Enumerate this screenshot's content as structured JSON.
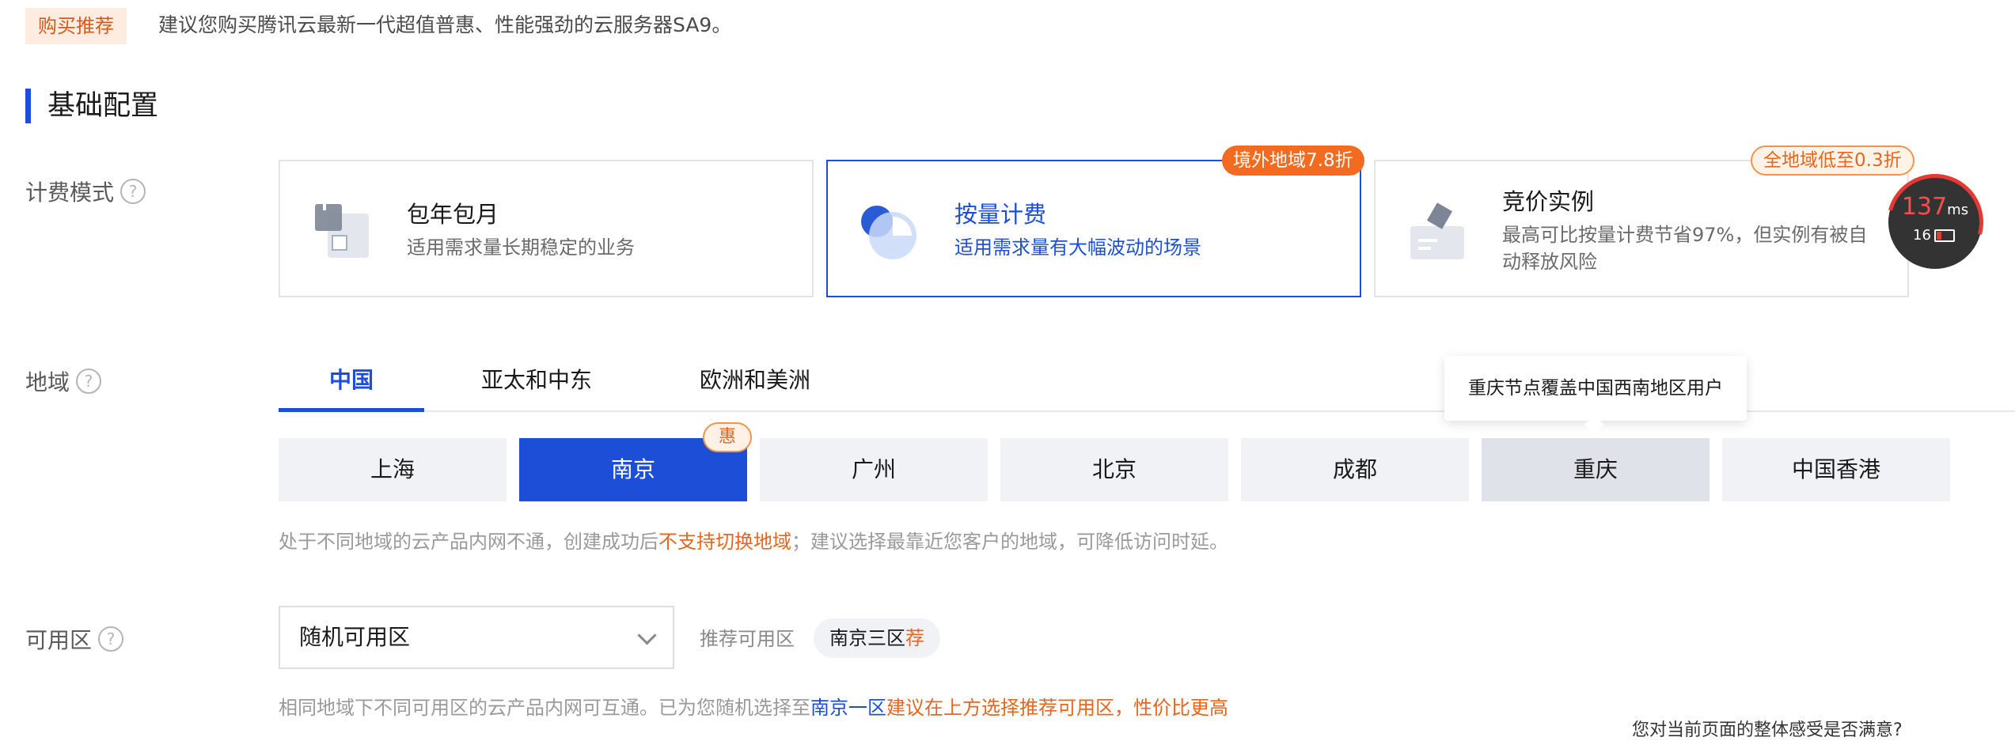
{
  "recommend": {
    "tag": "购买推荐",
    "text": "建议您购买腾讯云最新一代超值普惠、性能强劲的云服务器SA9。"
  },
  "section": {
    "title": "基础配置"
  },
  "billing": {
    "label": "计费模式",
    "help": "?",
    "cards": [
      {
        "title": "包年包月",
        "desc": "适用需求量长期稳定的业务",
        "badge": ""
      },
      {
        "title": "按量计费",
        "desc": "适用需求量有大幅波动的场景",
        "badge": "境外地域7.8折"
      },
      {
        "title": "竞价实例",
        "desc": "最高可比按量计费节省97%，但实例有被自动释放风险",
        "badge": "全地域低至0.3折"
      }
    ]
  },
  "latency": {
    "ms": "137",
    "unit": "ms",
    "sub": "16"
  },
  "region": {
    "label": "地域",
    "help": "?",
    "tabs": [
      "中国",
      "亚太和中东",
      "欧洲和美洲"
    ],
    "tooltip": "重庆节点覆盖中国西南地区用户",
    "cities": [
      "上海",
      "南京",
      "广州",
      "北京",
      "成都",
      "重庆",
      "中国香港"
    ],
    "promo_badge": "惠",
    "note_prefix": "处于不同地域的云产品内网不通，创建成功后",
    "note_highlight": "不支持切换地域",
    "note_suffix": "；建议选择最靠近您客户的地域，可降低访问时延。"
  },
  "zone": {
    "label": "可用区",
    "help": "?",
    "select_value": "随机可用区",
    "recommend_label": "推荐可用区",
    "recommend_chip": "南京三区",
    "recommend_chip_tag": "荐",
    "note_prefix": "相同地域下不同可用区的云产品内网可互通。已为您随机选择至",
    "note_zone": "南京一区",
    "note_suffix": "建议在上方选择推荐可用区，性价比更高"
  },
  "survey": {
    "text": "您对当前页面的整体感受是否满意?"
  },
  "colors": {
    "accent": "#1d4ed8",
    "orange": "#f26b21"
  }
}
